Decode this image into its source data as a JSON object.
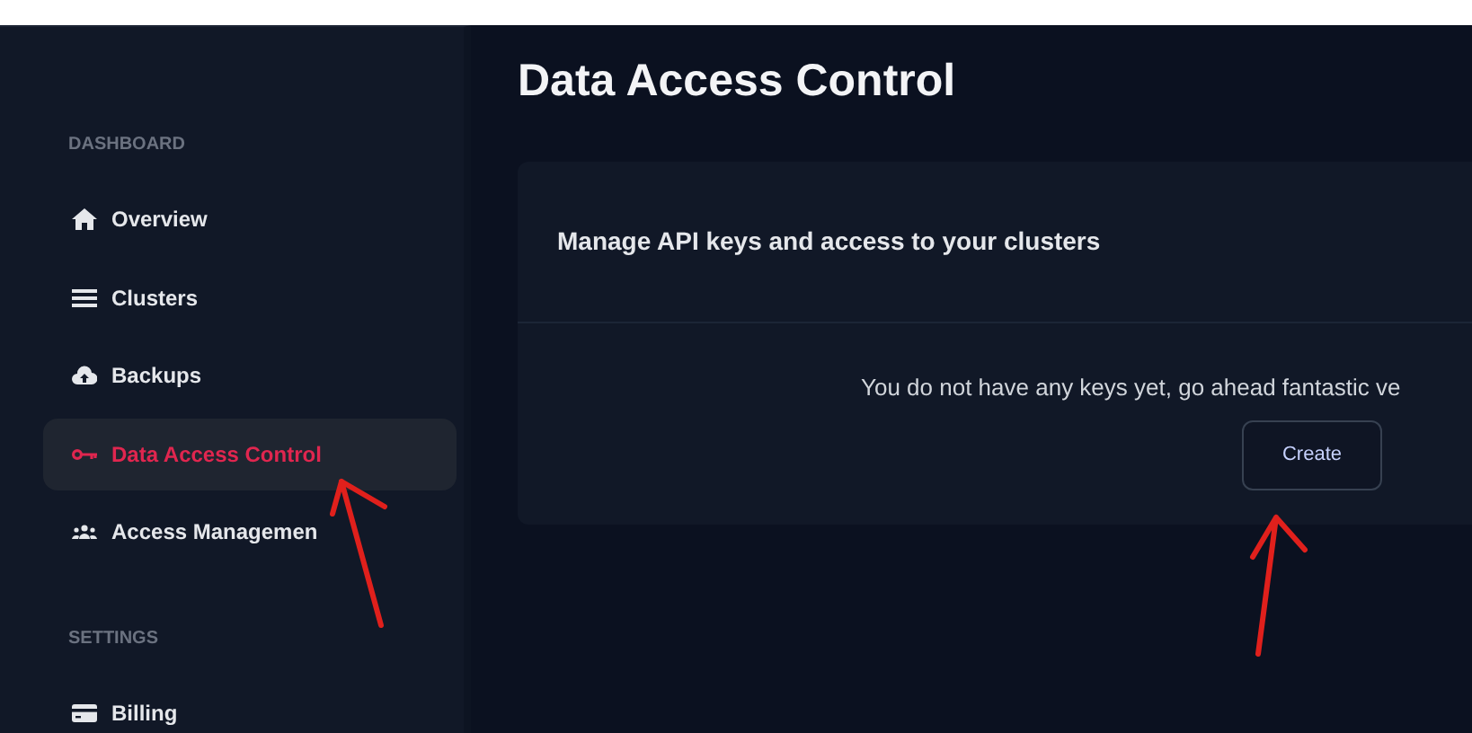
{
  "sidebar": {
    "sections": [
      {
        "label": "DASHBOARD",
        "items": [
          {
            "label": "Overview",
            "kind": "home",
            "selected": false
          },
          {
            "label": "Clusters",
            "kind": "list",
            "selected": false
          },
          {
            "label": "Backups",
            "kind": "cloud",
            "selected": false
          },
          {
            "label": "Data Access Control",
            "kind": "key",
            "selected": true
          },
          {
            "label": "Access Managemen",
            "kind": "users",
            "selected": false
          }
        ]
      },
      {
        "label": "SETTINGS",
        "items": [
          {
            "label": "Billing",
            "kind": "card",
            "selected": false
          }
        ]
      }
    ]
  },
  "page": {
    "title": "Data Access Control",
    "card": {
      "heading": "Manage API keys and access to your clusters",
      "message": "You do not have any keys yet, go ahead fantastic ve",
      "button": "Create"
    }
  }
}
